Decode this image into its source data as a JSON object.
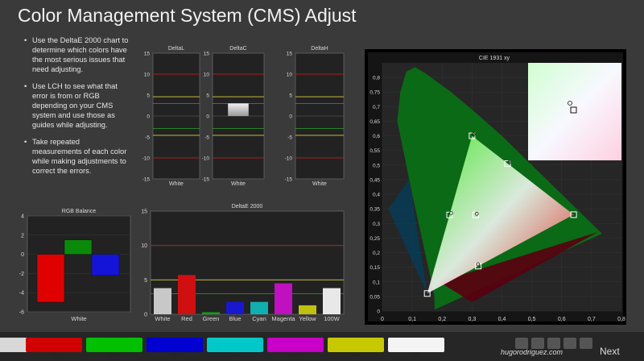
{
  "title": "Color Management System (CMS) Adjust",
  "instructions": [
    "Use the DeltaE 2000 chart to determine which colors have the most serious issues that need adjusting.",
    "Use LCH to see what that error is from or RGB depending on your CMS system and use those as guides while adjusting.",
    "Take repeated measurements of each color while making adjustments to correct the errors."
  ],
  "colors": {
    "red": "#e00000",
    "green": "#0a8a0a",
    "blue": "#1414d8",
    "yellow_line": "#d8d040",
    "green_line": "#30a030",
    "red_line": "#d02020",
    "bg_panel": "#222222"
  },
  "chart_data": [
    {
      "type": "bar",
      "title": "DeltaL",
      "categories": [
        "White"
      ],
      "series": [
        {
          "values": [
            0
          ]
        }
      ],
      "ylim": [
        -15,
        15
      ],
      "yticks": [
        "15",
        "10",
        "5",
        "0",
        "-5",
        "-10",
        "-15"
      ]
    },
    {
      "type": "bar",
      "title": "DeltaC",
      "categories": [
        "White"
      ],
      "series": [
        {
          "values": [
            3
          ]
        }
      ],
      "ylim": [
        -15,
        15
      ],
      "yticks": [
        "15",
        "10",
        "5",
        "0",
        "-5",
        "-10",
        "-15"
      ]
    },
    {
      "type": "bar",
      "title": "DeltaH",
      "categories": [
        "White"
      ],
      "series": [
        {
          "values": [
            0
          ]
        }
      ],
      "ylim": [
        -15,
        15
      ],
      "yticks": [
        "15",
        "10",
        "5",
        "0",
        "-5",
        "-10",
        "-15"
      ]
    },
    {
      "type": "bar",
      "title": "RGB Balance",
      "categories": [
        "White"
      ],
      "series": [
        {
          "values": [
            -5,
            1.5,
            -2.2
          ]
        }
      ],
      "ylim": [
        -6,
        4
      ],
      "yticks": [
        "4",
        "2",
        "0",
        "-2",
        "-4",
        "-6"
      ]
    },
    {
      "type": "bar",
      "title": "DeltaE 2000",
      "categories": [
        "White",
        "Red",
        "Green",
        "Blue",
        "Cyan",
        "Magenta",
        "Yellow",
        "100W"
      ],
      "series": [
        {
          "values": [
            3.8,
            5.7,
            0.3,
            1.8,
            1.8,
            4.5,
            1.3,
            3.8
          ]
        }
      ],
      "ylim": [
        0,
        15
      ],
      "yticks": [
        "15",
        "10",
        "5",
        "0"
      ]
    },
    {
      "type": "scatter",
      "title": "CIE 1931 xy",
      "xlim": [
        0,
        0.8
      ],
      "ylim": [
        0,
        0.85
      ],
      "xticks": [
        "0",
        "0,1",
        "0,2",
        "0,3",
        "0,4",
        "0,5",
        "0,6",
        "0,7",
        "0,8"
      ],
      "yticks": [
        "0",
        "0,05",
        "0,1",
        "0,15",
        "0,2",
        "0,25",
        "0,3",
        "0,35",
        "0,4",
        "0,45",
        "0,5",
        "0,55",
        "0,6",
        "0,65",
        "0,7",
        "0,75",
        "0,8"
      ],
      "targets": [
        {
          "name": "Red",
          "x": 0.64,
          "y": 0.33
        },
        {
          "name": "Green",
          "x": 0.3,
          "y": 0.6
        },
        {
          "name": "Blue",
          "x": 0.15,
          "y": 0.06
        },
        {
          "name": "Cyan",
          "x": 0.225,
          "y": 0.329
        },
        {
          "name": "Magenta",
          "x": 0.321,
          "y": 0.154
        },
        {
          "name": "Yellow",
          "x": 0.419,
          "y": 0.505
        },
        {
          "name": "White",
          "x": 0.3127,
          "y": 0.329
        }
      ],
      "measured": [
        {
          "x": 0.305,
          "y": 0.605
        },
        {
          "x": 0.425,
          "y": 0.51
        },
        {
          "x": 0.23,
          "y": 0.335
        },
        {
          "x": 0.316,
          "y": 0.333
        },
        {
          "x": 0.32,
          "y": 0.16
        },
        {
          "x": 0.15,
          "y": 0.06
        },
        {
          "x": 0.64,
          "y": 0.33
        }
      ]
    }
  ],
  "swatches": [
    {
      "label": "",
      "color": "#d8d8d8"
    },
    {
      "label": "Red",
      "color": "#d00000"
    },
    {
      "label": "Green",
      "color": "#00c000"
    },
    {
      "label": "Blue",
      "color": "#0000d0"
    },
    {
      "label": "Cyan",
      "color": "#00c8c8"
    },
    {
      "label": "Magenta",
      "color": "#c800c8"
    },
    {
      "label": "Yellow",
      "color": "#c8c800"
    },
    {
      "label": "100W",
      "color": "#f4f4f4"
    }
  ],
  "footer": {
    "brand": "hugorodriguez.com",
    "next": "Next"
  }
}
